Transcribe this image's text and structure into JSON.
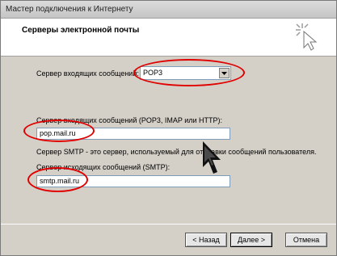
{
  "window": {
    "title": "Мастер подключения к Интернету"
  },
  "header": {
    "heading": "Серверы электронной почты"
  },
  "incoming_type": {
    "label": "Сервер входящих сообщений:",
    "selected": "POP3"
  },
  "incoming_server": {
    "label": "Сервер входящих сообщений (POP3, IMAP или HTTP):",
    "value": "pop.mail.ru"
  },
  "smtp_hint": "Сервер SMTP - это сервер, используемый для отправки сообщений  пользователя.",
  "outgoing_server": {
    "label": "Сервер исходящих сообщений (SMTP):",
    "value": "smtp.mail.ru"
  },
  "buttons": {
    "back": "< Назад",
    "next": "Далее >",
    "cancel": "Отмена"
  },
  "colors": {
    "annotation": "#e00000",
    "dialog_bg": "#d4d0c8"
  }
}
